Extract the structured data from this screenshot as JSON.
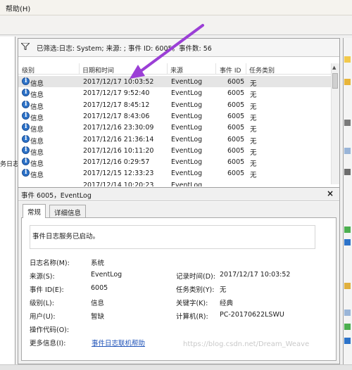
{
  "menu": {
    "help_label": "帮助(H)"
  },
  "left_pane": {
    "partial_text": "务日志"
  },
  "filter": {
    "text": "已筛选:日志: System; 来源: ; 事件 ID: 6005。事件数: 56"
  },
  "list": {
    "columns": [
      "级别",
      "日期和时间",
      "来源",
      "事件 ID",
      "任务类别"
    ],
    "rows": [
      {
        "level": "信息",
        "datetime": "2017/12/17 10:03:52",
        "source": "EventLog",
        "event_id": "6005",
        "category": "无"
      },
      {
        "level": "信息",
        "datetime": "2017/12/17 9:52:40",
        "source": "EventLog",
        "event_id": "6005",
        "category": "无"
      },
      {
        "level": "信息",
        "datetime": "2017/12/17 8:45:12",
        "source": "EventLog",
        "event_id": "6005",
        "category": "无"
      },
      {
        "level": "信息",
        "datetime": "2017/12/17 8:43:06",
        "source": "EventLog",
        "event_id": "6005",
        "category": "无"
      },
      {
        "level": "信息",
        "datetime": "2017/12/16 23:30:09",
        "source": "EventLog",
        "event_id": "6005",
        "category": "无"
      },
      {
        "level": "信息",
        "datetime": "2017/12/16 21:36:14",
        "source": "EventLog",
        "event_id": "6005",
        "category": "无"
      },
      {
        "level": "信息",
        "datetime": "2017/12/16 10:11:20",
        "source": "EventLog",
        "event_id": "6005",
        "category": "无"
      },
      {
        "level": "信息",
        "datetime": "2017/12/16 0:29:57",
        "source": "EventLog",
        "event_id": "6005",
        "category": "无"
      },
      {
        "level": "信息",
        "datetime": "2017/12/15 12:33:23",
        "source": "EventLog",
        "event_id": "6005",
        "category": "无"
      },
      {
        "level": "",
        "datetime": "2017/12/14 10:20:23",
        "source": "EventLog",
        "event_id": "",
        "category": ""
      }
    ]
  },
  "detail": {
    "title": "事件 6005，EventLog",
    "tabs": [
      "常规",
      "详细信息"
    ],
    "description": "事件日志服务已启动。",
    "fields": {
      "log_name_label": "日志名称(M):",
      "log_name": "系统",
      "source_label": "来源(S):",
      "source": "EventLog",
      "logged_label": "记录时间(D):",
      "logged": "2017/12/17 10:03:52",
      "event_id_label": "事件 ID(E):",
      "event_id": "6005",
      "task_label": "任务类别(Y):",
      "task": "无",
      "level_label": "级别(L):",
      "level": "信息",
      "keywords_label": "关键字(K):",
      "keywords": "经典",
      "user_label": "用户(U):",
      "user": "暂缺",
      "computer_label": "计算机(R):",
      "computer": "PC-20170622LSWU",
      "opcode_label": "操作代码(O):",
      "more_info_label": "更多信息(I):",
      "more_info_link": "事件日志联机帮助"
    }
  },
  "watermark": "https://blog.csdn.net/Dream_Weave",
  "colors": {
    "arrow": "#9b3fd6",
    "link": "#1f53b8",
    "info_icon": "#2d73c9"
  },
  "icons": [
    "filter-icon",
    "info-icon",
    "close-icon"
  ]
}
